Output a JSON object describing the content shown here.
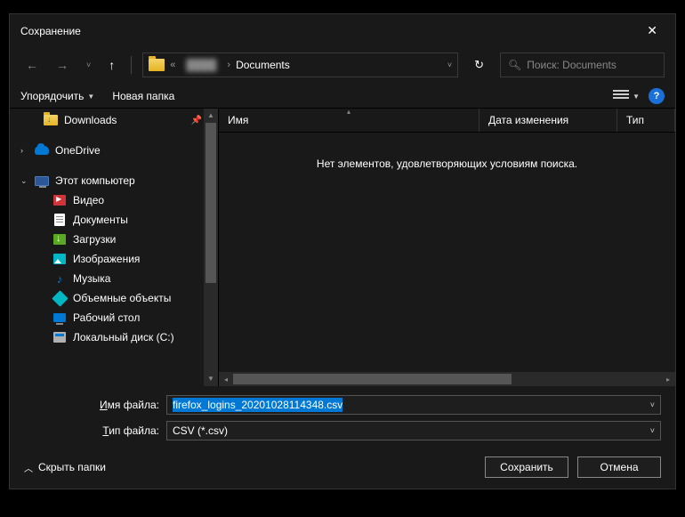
{
  "title": "Сохранение",
  "breadcrumb": {
    "current": "Documents",
    "sep": "«",
    "chev": "›"
  },
  "search": {
    "placeholder": "Поиск: Documents"
  },
  "toolbar": {
    "organize": "Упорядочить",
    "newFolder": "Новая папка"
  },
  "columns": {
    "name": "Имя",
    "date": "Дата изменения",
    "type": "Тип"
  },
  "emptyMsg": "Нет элементов, удовлетворяющих условиям поиска.",
  "sidebar": {
    "downloads": "Downloads",
    "onedrive": "OneDrive",
    "thispc": "Этот компьютер",
    "video": "Видео",
    "documents": "Документы",
    "downloads2": "Загрузки",
    "images": "Изображения",
    "music": "Музыка",
    "objects3d": "Объемные объекты",
    "desktop": "Рабочий стол",
    "localdisk": "Локальный диск (C:)"
  },
  "fields": {
    "filenameLabel": "Имя файла:",
    "filenameValue": "firefox_logins_20201028114348.csv",
    "filetypeLabel": "Тип файла:",
    "filetypeValue": "CSV (*.csv)"
  },
  "footer": {
    "hideFolders": "Скрыть папки",
    "save": "Сохранить",
    "cancel": "Отмена"
  }
}
